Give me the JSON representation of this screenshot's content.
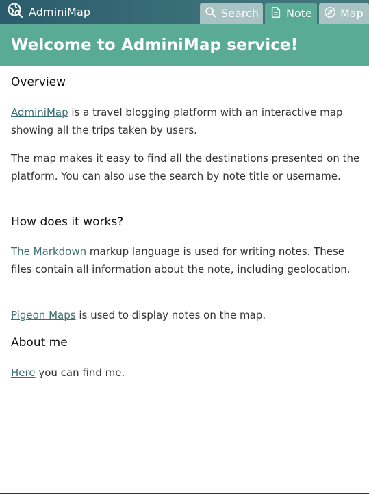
{
  "app": {
    "name": "AdminiMap"
  },
  "tabs": [
    {
      "label": "Search",
      "icon": "search-icon",
      "active": false
    },
    {
      "label": "Note",
      "icon": "note-icon",
      "active": true
    },
    {
      "label": "Map",
      "icon": "compass-icon",
      "active": false
    }
  ],
  "hero": {
    "title": "Welcome to AdminiMap service!"
  },
  "sections": {
    "overview": {
      "heading": "Overview",
      "p1_link": "AdminiMap",
      "p1_text": " is a travel blogging platform with an interactive map showing all the trips taken by users.",
      "p2_text": "The map makes it easy to find all the destinations presented on the platform. You can also use the search by note title or username."
    },
    "how": {
      "heading": "How does it works?",
      "p3_link": "The Markdown",
      "p3_text": " markup language is used for writing notes. These files contain all information about the note, including geolocation.",
      "p4_link": "Pigeon Maps",
      "p4_text": " is used to display notes on the map."
    },
    "about": {
      "heading": "About me",
      "p5_link": "Here",
      "p5_text": " you can find me."
    }
  },
  "colors": {
    "topbar": "#2a5b6c",
    "accent": "#59ab96",
    "tab_inactive": "#a9c2c3",
    "link": "#3c6f74"
  }
}
